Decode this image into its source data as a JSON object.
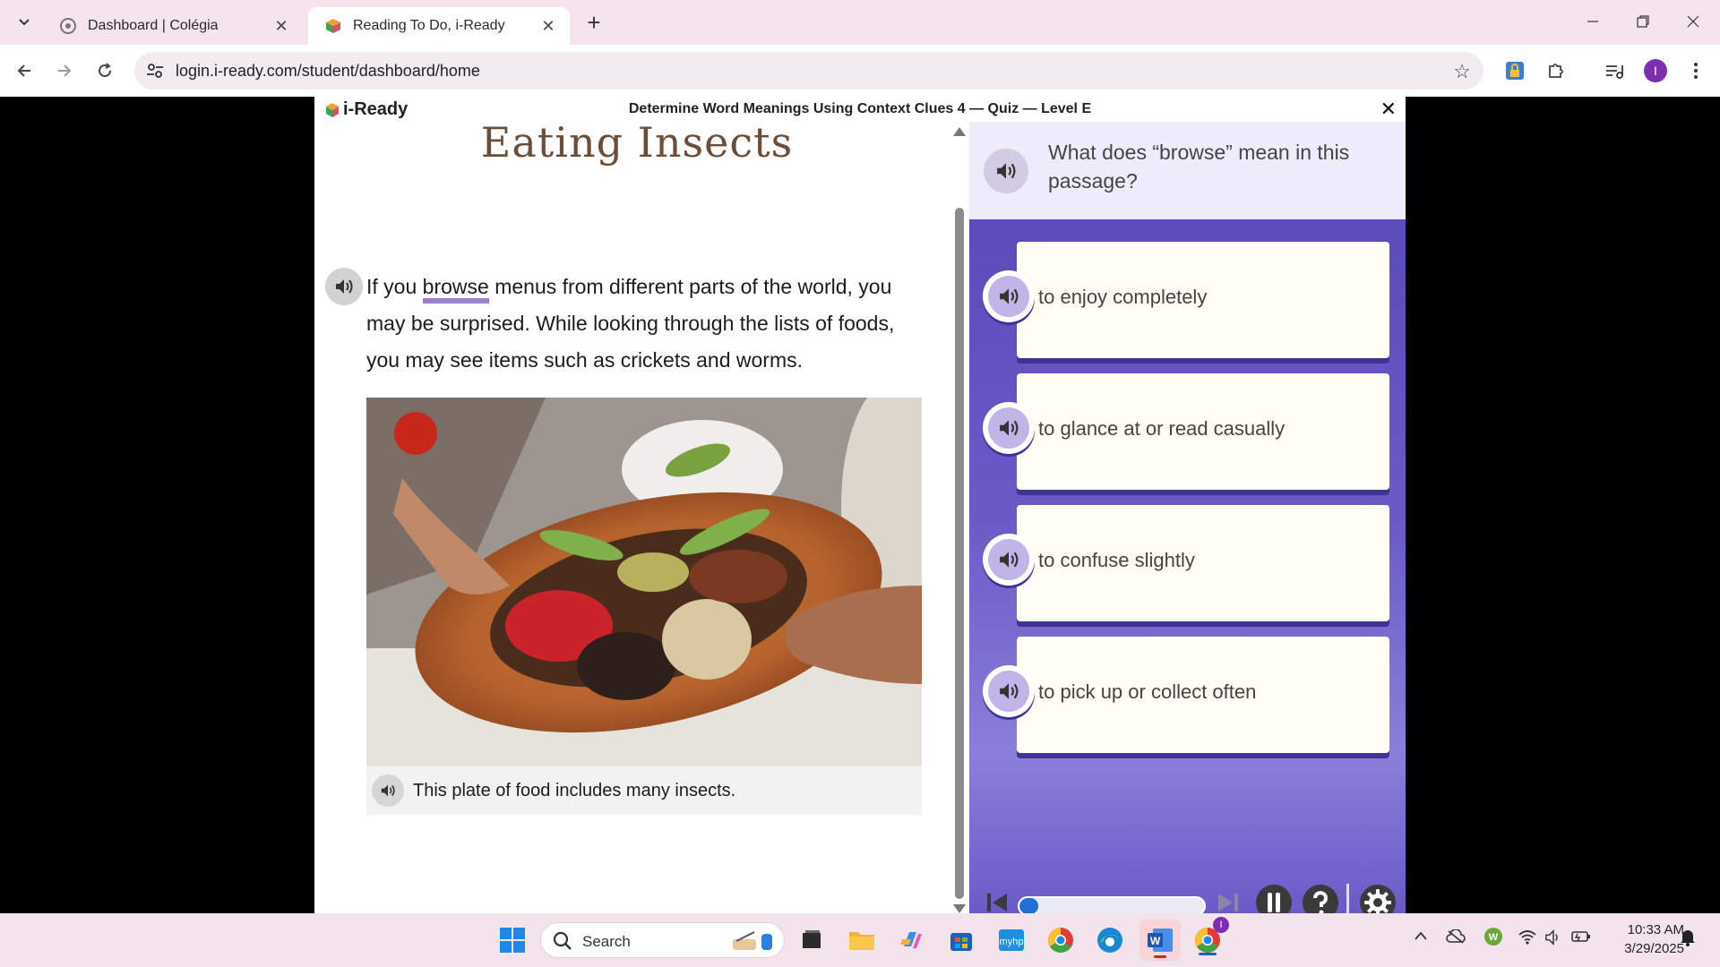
{
  "browser": {
    "tabs": [
      {
        "title": "Dashboard | Colégia",
        "active": false
      },
      {
        "title": "Reading To Do, i-Ready",
        "active": true
      }
    ],
    "url": "login.i-ready.com/student/dashboard/home"
  },
  "app": {
    "logo_text": "i-Ready",
    "quiz_title": "Determine Word Meanings Using Context Clues 4 — Quiz — Level E",
    "close_label": "✕"
  },
  "passage": {
    "title": "Eating Insects",
    "text_before": "If you ",
    "highlighted_word": "browse",
    "text_after": " menus from different parts of the world, you may be surprised. While looking through the lists of foods, you may see items such as crickets and worms.",
    "caption": "This plate of food includes many insects."
  },
  "question": {
    "prompt": "What does “browse” mean in this passage?",
    "answers": [
      {
        "label": "to enjoy completely"
      },
      {
        "label": "to glance at or read casually"
      },
      {
        "label": "to confuse slightly"
      },
      {
        "label": "to pick up or collect often"
      }
    ],
    "progress_fraction": 0.1
  },
  "taskbar": {
    "search_label": "Search",
    "time": "10:33 AM",
    "date": "3/29/2025",
    "chrome_badge": "I"
  },
  "colors": {
    "accent_purple": "#5746b6",
    "highlight": "#9b7ed0",
    "card": "#fffef5"
  }
}
